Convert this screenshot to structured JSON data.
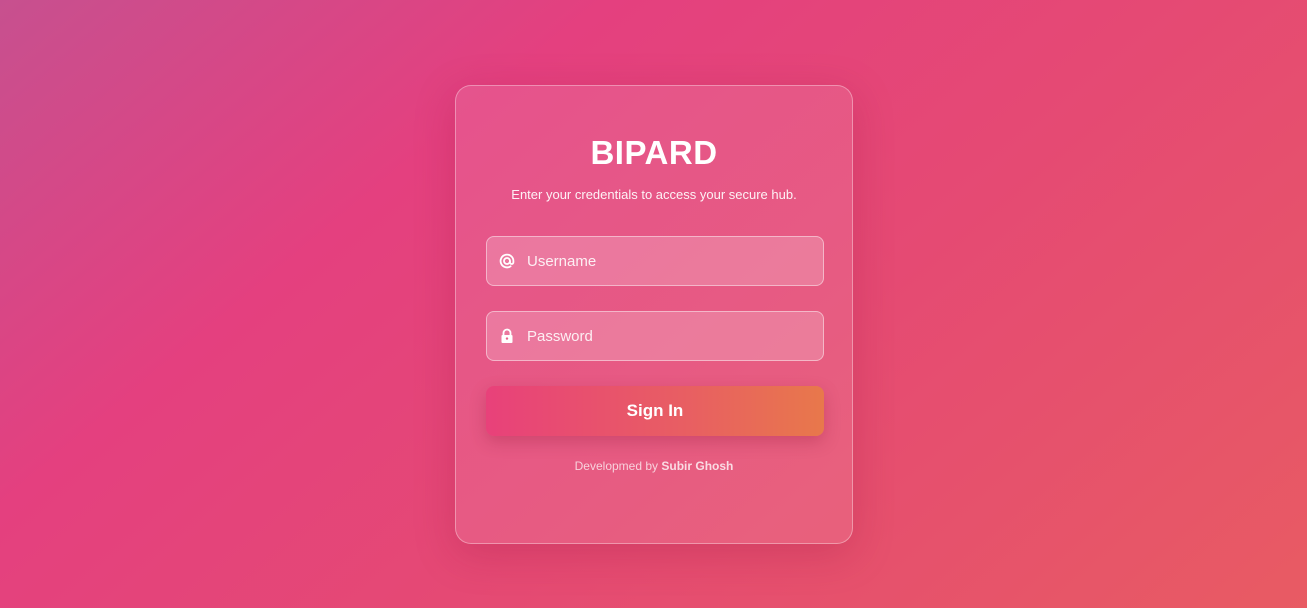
{
  "login": {
    "title": "BIPARD",
    "subtitle": "Enter your credentials to access your secure hub.",
    "username": {
      "placeholder": "Username",
      "value": "",
      "icon": "at-icon"
    },
    "password": {
      "placeholder": "Password",
      "value": "",
      "icon": "lock-icon"
    },
    "submit_label": "Sign In",
    "footer_prefix": "Developmed by ",
    "footer_author": "Subir Ghosh"
  },
  "colors": {
    "background_start": "#c7508f",
    "background_mid": "#e4407f",
    "background_end": "#e85b63",
    "button_start": "#e8417a",
    "button_end": "#e8784b",
    "text": "#ffffff"
  }
}
